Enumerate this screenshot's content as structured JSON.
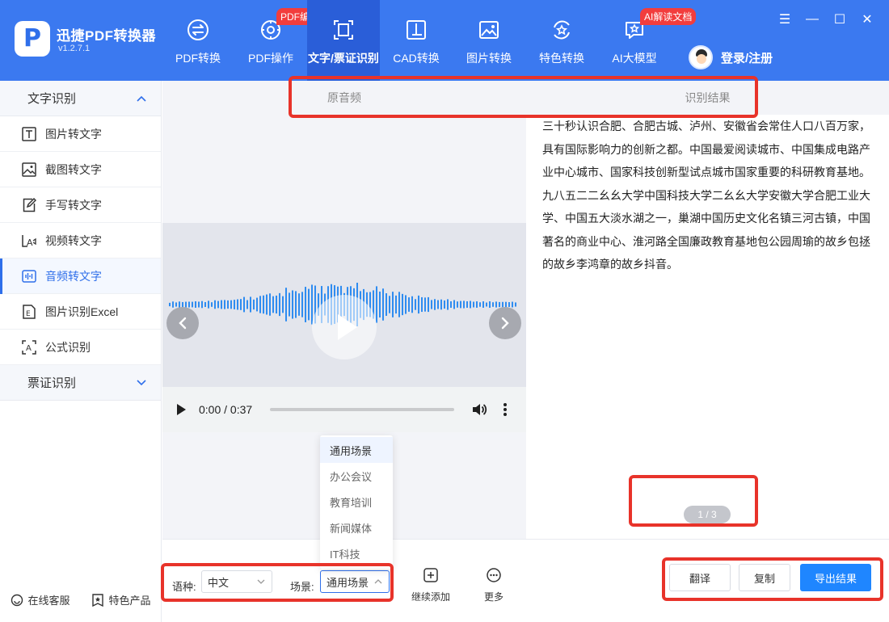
{
  "app": {
    "logo_glyph": "P",
    "name": "迅捷PDF转换器",
    "version": "v1.2.7.1"
  },
  "nav": [
    {
      "label": "PDF转换",
      "icon": "convert-icon",
      "badge": ""
    },
    {
      "label": "PDF操作",
      "icon": "gear-icon",
      "badge": "PDF编辑"
    },
    {
      "label": "文字/票证识别",
      "icon": "scan-frame-icon",
      "badge": ""
    },
    {
      "label": "CAD转换",
      "icon": "cad-icon",
      "badge": ""
    },
    {
      "label": "图片转换",
      "icon": "image-icon",
      "badge": ""
    },
    {
      "label": "特色转换",
      "icon": "star-refresh-icon",
      "badge": ""
    },
    {
      "label": "AI大模型",
      "icon": "ai-star-icon",
      "badge": "AI解读文档"
    }
  ],
  "user": {
    "login_label": "登录/注册"
  },
  "window": {
    "menu": "☰",
    "minimize": "—",
    "maximize": "☐",
    "close": "✕"
  },
  "sidebar": {
    "group1": "文字识别",
    "items": [
      {
        "label": "图片转文字",
        "icon": "text-t-icon"
      },
      {
        "label": "截图转文字",
        "icon": "screenshot-icon"
      },
      {
        "label": "手写转文字",
        "icon": "handwrite-icon"
      },
      {
        "label": "视频转文字",
        "icon": "video-icon"
      },
      {
        "label": "音频转文字",
        "icon": "audio-icon"
      },
      {
        "label": "图片识别Excel",
        "icon": "excel-icon"
      },
      {
        "label": "公式识别",
        "icon": "formula-icon"
      }
    ],
    "group2": "票证识别",
    "footer": {
      "service": "在线客服",
      "products": "特色产品"
    }
  },
  "tabs": {
    "original": "原音频",
    "result": "识别结果"
  },
  "audio": {
    "time": "0:00 / 0:37"
  },
  "result": {
    "text": "三十秒认识合肥、合肥古城、泸州、安徽省会常住人口八百万家，具有国际影响力的创新之都。中国最爱阅读城市、中国集成电路产业中心城市、国家科技创新型试点城市国家重要的科研教育基地。九八五二二幺幺大学中国科技大学二幺幺大学安徽大学合肥工业大学、中国五大淡水湖之一，巢湖中国历史文化名镇三河古镇，中国著名的商业中心、淮河路全国廉政教育基地包公园周瑜的故乡包拯的故乡李鸿章的故乡抖音。",
    "page": "1 / 3"
  },
  "controls": {
    "lang_label": "语种:",
    "lang_value": "中文",
    "scene_label": "场景:",
    "scene_value": "通用场景",
    "add_label": "继续添加",
    "more_label": "更多",
    "translate": "翻译",
    "copy": "复制",
    "export": "导出结果"
  },
  "scene_options": [
    "通用场景",
    "办公会议",
    "教育培训",
    "新闻媒体",
    "IT科技"
  ],
  "colors": {
    "brand": "#3b79f0",
    "accent": "#1f86ff",
    "annotation": "#e8332a",
    "badge": "#f23d3d"
  }
}
